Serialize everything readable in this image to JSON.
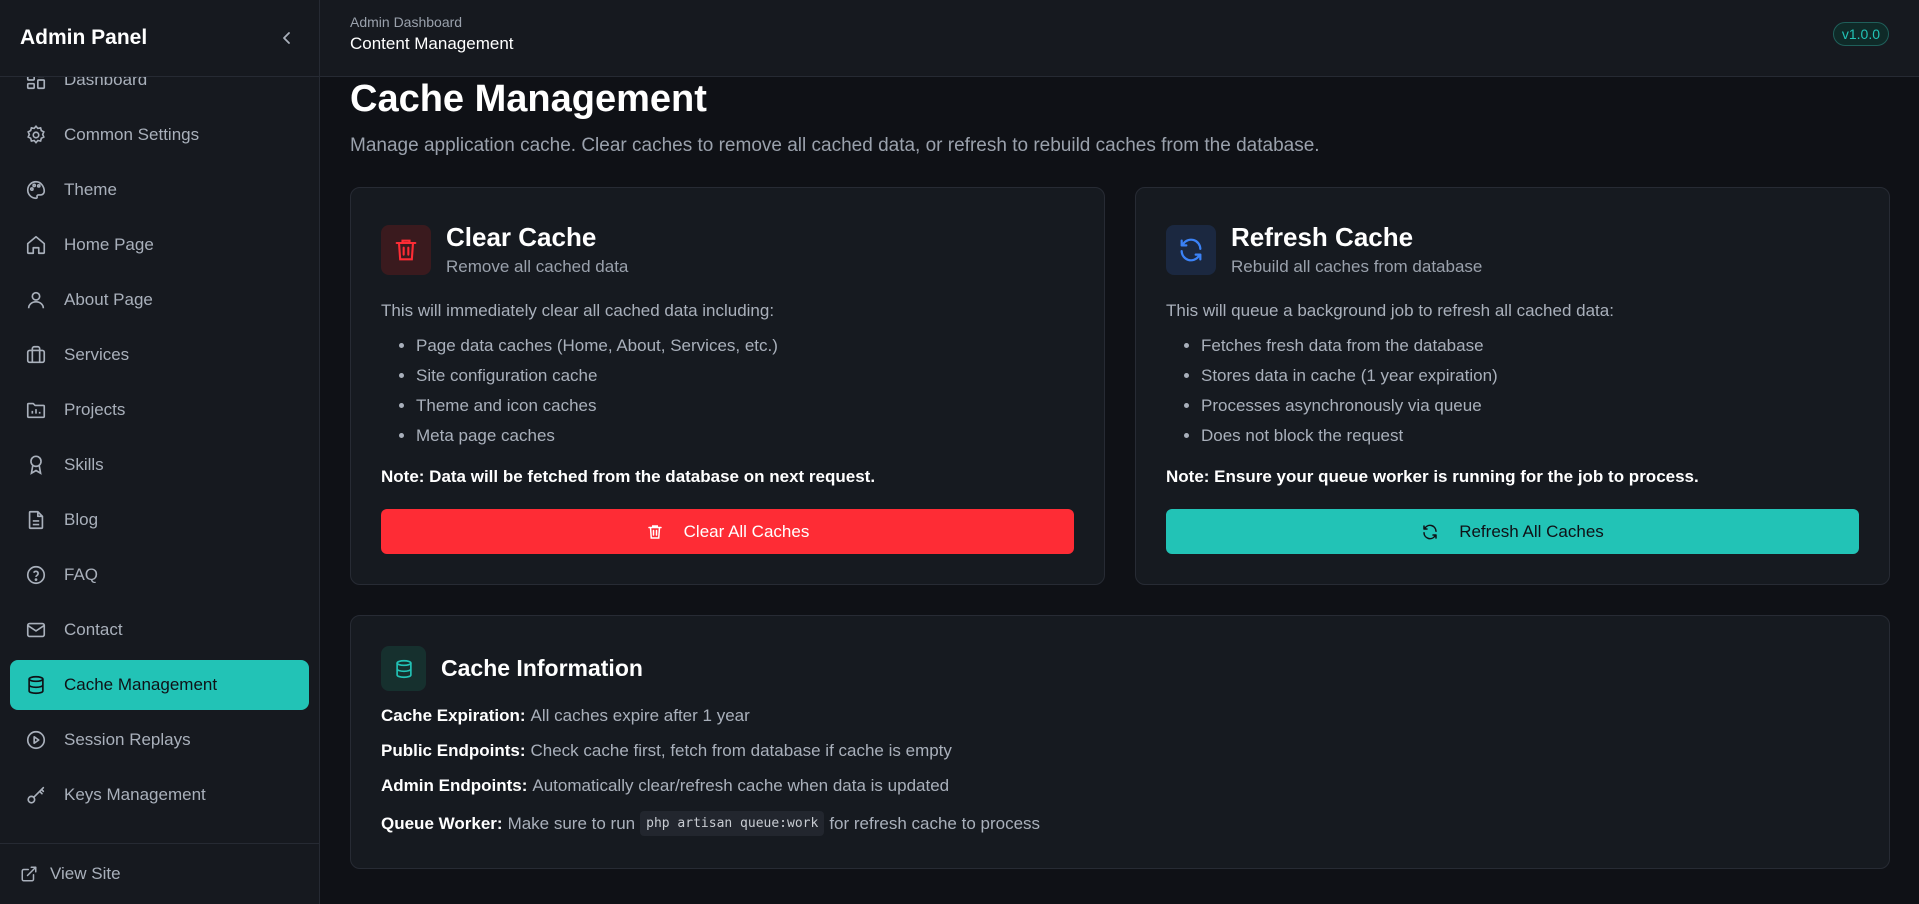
{
  "sidebar": {
    "title": "Admin Panel",
    "items": [
      {
        "label": "Dashboard",
        "icon": "dashboard-icon"
      },
      {
        "label": "Common Settings",
        "icon": "gear-icon"
      },
      {
        "label": "Theme",
        "icon": "palette-icon"
      },
      {
        "label": "Home Page",
        "icon": "home-icon"
      },
      {
        "label": "About Page",
        "icon": "user-icon"
      },
      {
        "label": "Services",
        "icon": "briefcase-icon"
      },
      {
        "label": "Projects",
        "icon": "folder-icon"
      },
      {
        "label": "Skills",
        "icon": "award-icon"
      },
      {
        "label": "Blog",
        "icon": "document-icon"
      },
      {
        "label": "FAQ",
        "icon": "help-circle-icon"
      },
      {
        "label": "Contact",
        "icon": "mail-icon"
      },
      {
        "label": "Cache Management",
        "icon": "database-icon",
        "active": true
      },
      {
        "label": "Session Replays",
        "icon": "play-circle-icon"
      },
      {
        "label": "Keys Management",
        "icon": "key-icon"
      }
    ],
    "footer": {
      "label": "View Site",
      "icon": "external-link-icon"
    }
  },
  "header": {
    "breadcrumb_parent": "Admin Dashboard",
    "breadcrumb_current": "Content Management",
    "version": "v1.0.0"
  },
  "main": {
    "title": "Cache Management",
    "subtitle": "Manage application cache. Clear caches to remove all cached data, or refresh to rebuild caches from the database.",
    "clear_card": {
      "title": "Clear Cache",
      "subtitle": "Remove all cached data",
      "intro": "This will immediately clear all cached data including:",
      "items": [
        "Page data caches (Home, About, Services, etc.)",
        "Site configuration cache",
        "Theme and icon caches",
        "Meta page caches"
      ],
      "note": "Note: Data will be fetched from the database on next request.",
      "button": "Clear All Caches"
    },
    "refresh_card": {
      "title": "Refresh Cache",
      "subtitle": "Rebuild all caches from database",
      "intro": "This will queue a background job to refresh all cached data:",
      "items": [
        "Fetches fresh data from the database",
        "Stores data in cache (1 year expiration)",
        "Processes asynchronously via queue",
        "Does not block the request"
      ],
      "note": "Note: Ensure your queue worker is running for the job to process.",
      "button": "Refresh All Caches"
    },
    "info": {
      "title": "Cache Information",
      "rows": [
        {
          "label": "Cache Expiration:",
          "text": "All caches expire after 1 year"
        },
        {
          "label": "Public Endpoints:",
          "text": "Check cache first, fetch from database if cache is empty"
        },
        {
          "label": "Admin Endpoints:",
          "text": "Automatically clear/refresh cache when data is updated"
        },
        {
          "label": "Queue Worker:",
          "text_before": "Make sure to run",
          "code": "php artisan queue:work",
          "text_after": "for refresh cache to process"
        }
      ]
    }
  },
  "colors": {
    "accent": "#22c3b6",
    "danger": "#fe2c35",
    "background": "#0f1116"
  }
}
